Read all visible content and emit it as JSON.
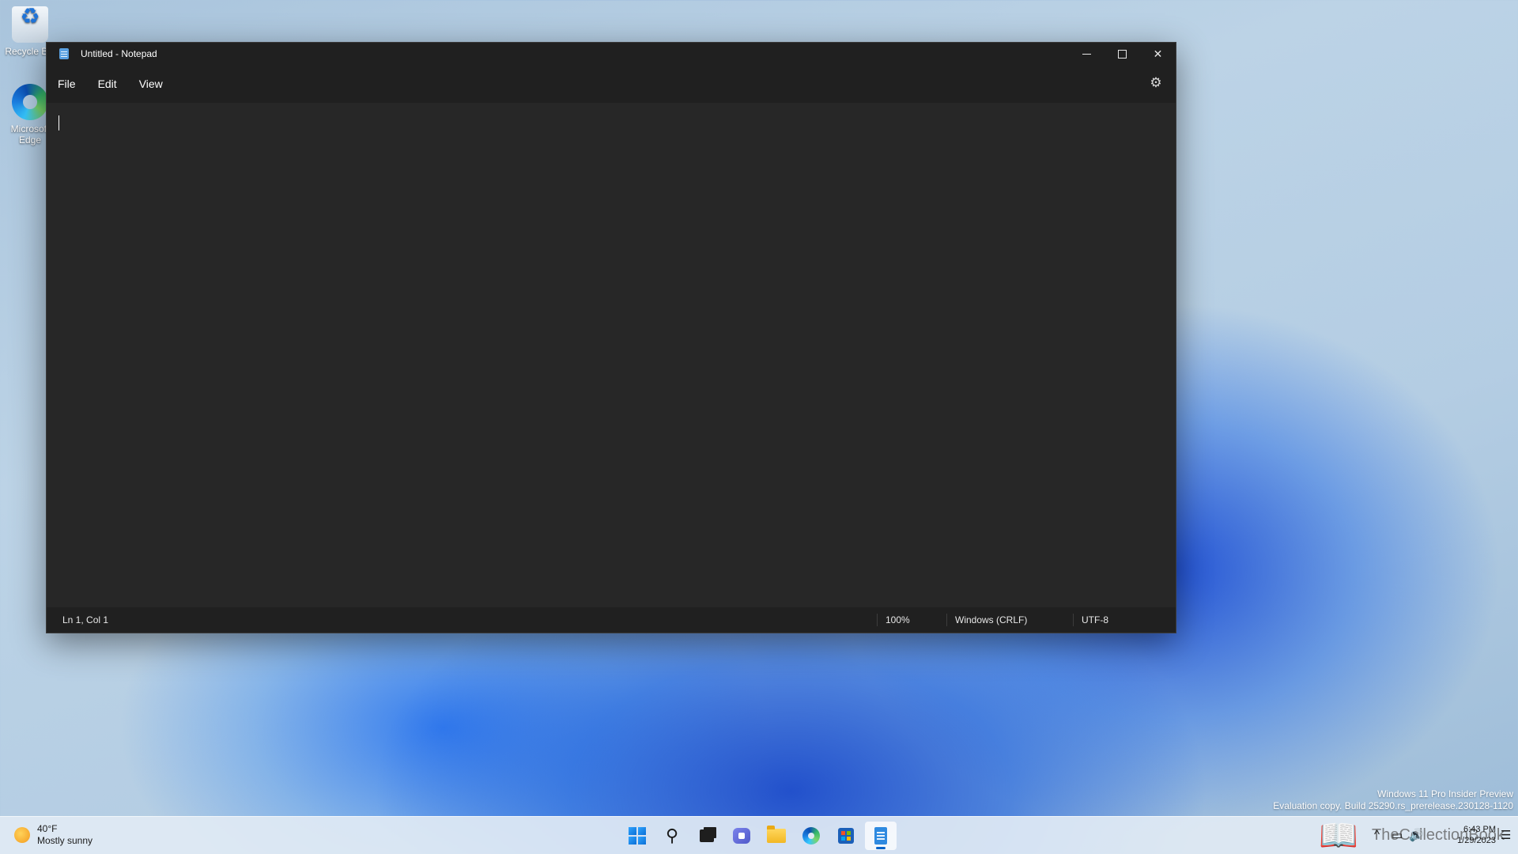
{
  "desktop": {
    "icons": [
      {
        "label": "Recycle Bin",
        "icon": "recycle-bin-icon"
      },
      {
        "label": "Microsoft Edge",
        "icon": "edge-icon"
      }
    ],
    "watermark": {
      "line1": "Windows 11 Pro Insider Preview",
      "line2": "Evaluation copy. Build 25290.rs_prerelease.230128-1120"
    }
  },
  "window": {
    "title": "Untitled - Notepad",
    "menu": [
      "File",
      "Edit",
      "View"
    ],
    "editor_text": "",
    "status": {
      "position": "Ln 1, Col 1",
      "zoom": "100%",
      "line_ending": "Windows (CRLF)",
      "encoding": "UTF-8"
    }
  },
  "taskbar": {
    "weather": {
      "temp": "40°F",
      "condition": "Mostly sunny"
    },
    "apps": [
      "start",
      "search",
      "task-view",
      "chat",
      "file-explorer",
      "edge",
      "store",
      "notepad"
    ],
    "active_app": "notepad",
    "overlay_text": "TheCollectionBook",
    "clock": {
      "time": "6:43 PM",
      "date": "1/29/2023"
    }
  },
  "colors": {
    "editor_bg": "#272727",
    "chrome_bg": "#202020",
    "accent": "#0a64c8"
  }
}
